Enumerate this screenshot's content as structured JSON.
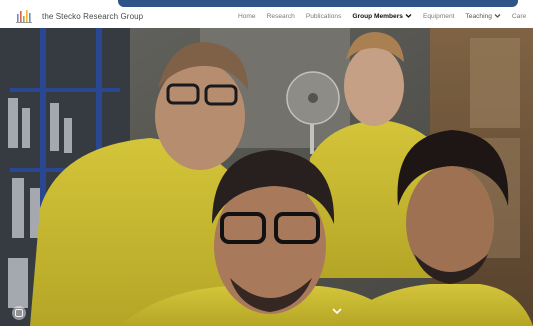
{
  "site": {
    "title": "the Stecko Research Group",
    "logo_icon": "research-group-logo-icon"
  },
  "nav": {
    "items": [
      {
        "label": "Home",
        "active": false,
        "dropdown": false
      },
      {
        "label": "Research",
        "active": false,
        "dropdown": false
      },
      {
        "label": "Publications",
        "active": false,
        "dropdown": false
      },
      {
        "label": "Group Members",
        "active": true,
        "dropdown": true
      },
      {
        "label": "Equipment",
        "active": false,
        "dropdown": false
      },
      {
        "label": "Teaching",
        "active": false,
        "dropdown": true
      },
      {
        "label": "Care",
        "active": false,
        "dropdown": false
      }
    ]
  },
  "hero": {
    "description_icon": "group-photo",
    "badge_icon": "image-badge-icon",
    "scroll_icon": "chevron-down-icon"
  },
  "colors": {
    "accent": "#2f5487",
    "shirt_yellow": "#e3d23a",
    "nav_active": "#111111",
    "nav_text": "#7a7a7a"
  }
}
